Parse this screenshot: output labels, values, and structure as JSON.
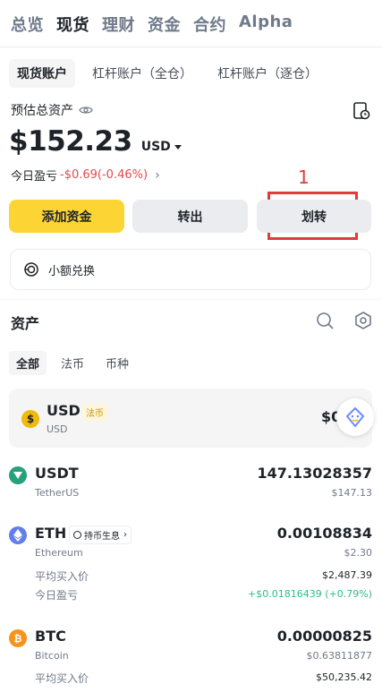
{
  "top_tabs": [
    {
      "label": "总览",
      "active": false
    },
    {
      "label": "现货",
      "active": true
    },
    {
      "label": "理财",
      "active": false
    },
    {
      "label": "资金",
      "active": false
    },
    {
      "label": "合约",
      "active": false
    },
    {
      "label": "Alpha",
      "active": false
    }
  ],
  "account_tabs": [
    {
      "label": "现货账户",
      "active": true
    },
    {
      "label": "杠杆账户（全仓）",
      "active": false
    },
    {
      "label": "杠杆账户（逐仓）",
      "active": false
    }
  ],
  "summary": {
    "estimated_label": "预估总资产",
    "balance": "$152.23",
    "currency": "USD",
    "pnl_label": "今日盈亏",
    "pnl_value": "-$0.69(-0.46%)"
  },
  "annotation": {
    "number": "1"
  },
  "actions": {
    "add_funds": "添加资金",
    "withdraw": "转出",
    "transfer": "划转"
  },
  "small_convert": {
    "label": "小额兑换"
  },
  "assets": {
    "title": "资产",
    "filters": [
      {
        "label": "全部",
        "active": true
      },
      {
        "label": "法币",
        "active": false
      },
      {
        "label": "币种",
        "active": false
      }
    ],
    "usd": {
      "symbol": "USD",
      "tag": "法币",
      "name": "USD",
      "amount_partial": "$0",
      "icon_glyph": "$"
    },
    "items": [
      {
        "symbol": "USDT",
        "name": "TetherUS",
        "amount": "147.13028357",
        "fiat": "$147.13",
        "color": "#26a17b",
        "icon": "usdt-icon"
      },
      {
        "symbol": "ETH",
        "name": "Ethereum",
        "amount": "0.00108834",
        "fiat": "$2.30",
        "badge": "持币生息",
        "avg_label": "平均买入价",
        "avg_value": "$2,487.39",
        "pnl_label": "今日盈亏",
        "pnl_value": "+$0.01816439 (+0.79%)",
        "color": "#627eea",
        "icon": "eth-icon"
      },
      {
        "symbol": "BTC",
        "name": "Bitcoin",
        "amount": "0.00000825",
        "fiat": "$0.63811877",
        "avg_label": "平均买入价",
        "avg_value": "$50,235.42",
        "color": "#f7931a",
        "icon": "btc-icon"
      }
    ]
  }
}
